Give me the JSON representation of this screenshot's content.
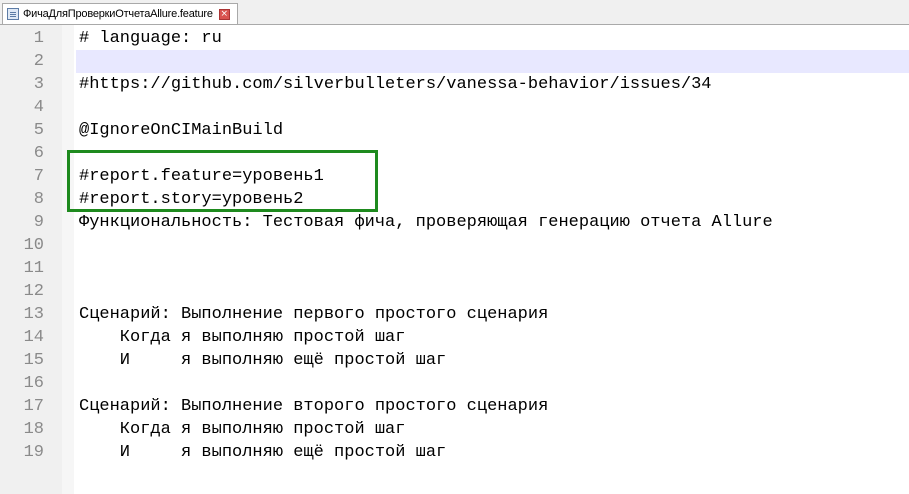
{
  "tab": {
    "title": "ФичаДляПроверкиОтчетаAllure.feature",
    "close_glyph": "×"
  },
  "editor": {
    "line_numbers": [
      "1",
      "2",
      "3",
      "4",
      "5",
      "6",
      "7",
      "8",
      "9",
      "10",
      "11",
      "12",
      "13",
      "14",
      "15",
      "16",
      "17",
      "18",
      "19"
    ],
    "lines": [
      "# language: ru",
      "",
      "#https://github.com/silverbulleters/vanessa-behavior/issues/34",
      "",
      "@IgnoreOnCIMainBuild",
      "",
      "#report.feature=уровень1",
      "#report.story=уровень2",
      "Функциональность: Тестовая фича, проверяющая генерацию отчета Allure",
      "",
      "",
      "",
      "Сценарий: Выполнение первого простого сценария",
      "    Когда я выполняю простой шаг",
      "    И     я выполняю ещё простой шаг",
      "",
      "Сценарий: Выполнение второго простого сценария",
      "    Когда я выполняю простой шаг",
      "    И     я выполняю ещё простой шаг"
    ],
    "highlight_color": "#1e8a1e"
  }
}
